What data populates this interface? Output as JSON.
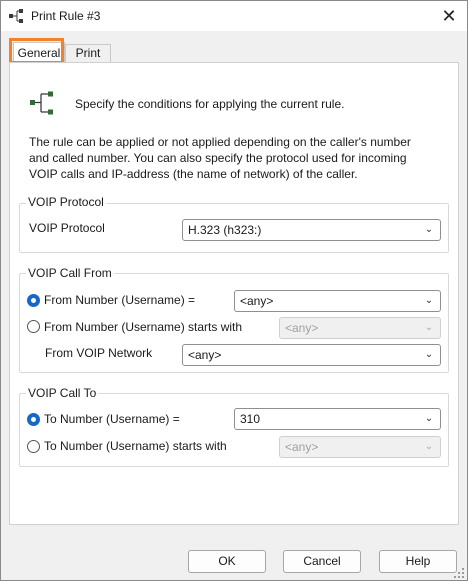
{
  "window": {
    "title": "Print Rule #3",
    "app_icon": "rule-icon",
    "close_icon": "close-icon",
    "close_glyph": "✕"
  },
  "tabs": [
    {
      "label": "General",
      "active": true
    },
    {
      "label": "Print",
      "active": false
    }
  ],
  "intro": {
    "icon": "rule-tree-icon",
    "heading": "Specify the conditions for applying the current rule.",
    "description_lines": [
      "The rule can be applied or not applied depending on the caller's number",
      "and called number. You can also specify the protocol used for incoming",
      "VOIP calls and IP-address (the name of network) of the caller."
    ]
  },
  "voip_protocol": {
    "group_title": "VOIP Protocol",
    "label": "VOIP Protocol",
    "value": "H.323 (h323:)"
  },
  "voip_call_from": {
    "group_title": "VOIP Call From",
    "option_equals": {
      "label": "From Number (Username) =",
      "selected": true,
      "value": "<any>"
    },
    "option_starts_with": {
      "label": "From Number (Username) starts with",
      "selected": false,
      "value": "<any>"
    },
    "network": {
      "label": "From VOIP Network",
      "value": "<any>"
    }
  },
  "voip_call_to": {
    "group_title": "VOIP Call To",
    "option_equals": {
      "label": "To Number (Username) =",
      "selected": true,
      "value": "310"
    },
    "option_starts_with": {
      "label": "To Number (Username) starts with",
      "selected": false,
      "value": "<any>"
    }
  },
  "buttons": {
    "ok": "OK",
    "cancel": "Cancel",
    "help": "Help"
  },
  "colors": {
    "accent": "#1668c7",
    "highlight": "#f0822d"
  }
}
